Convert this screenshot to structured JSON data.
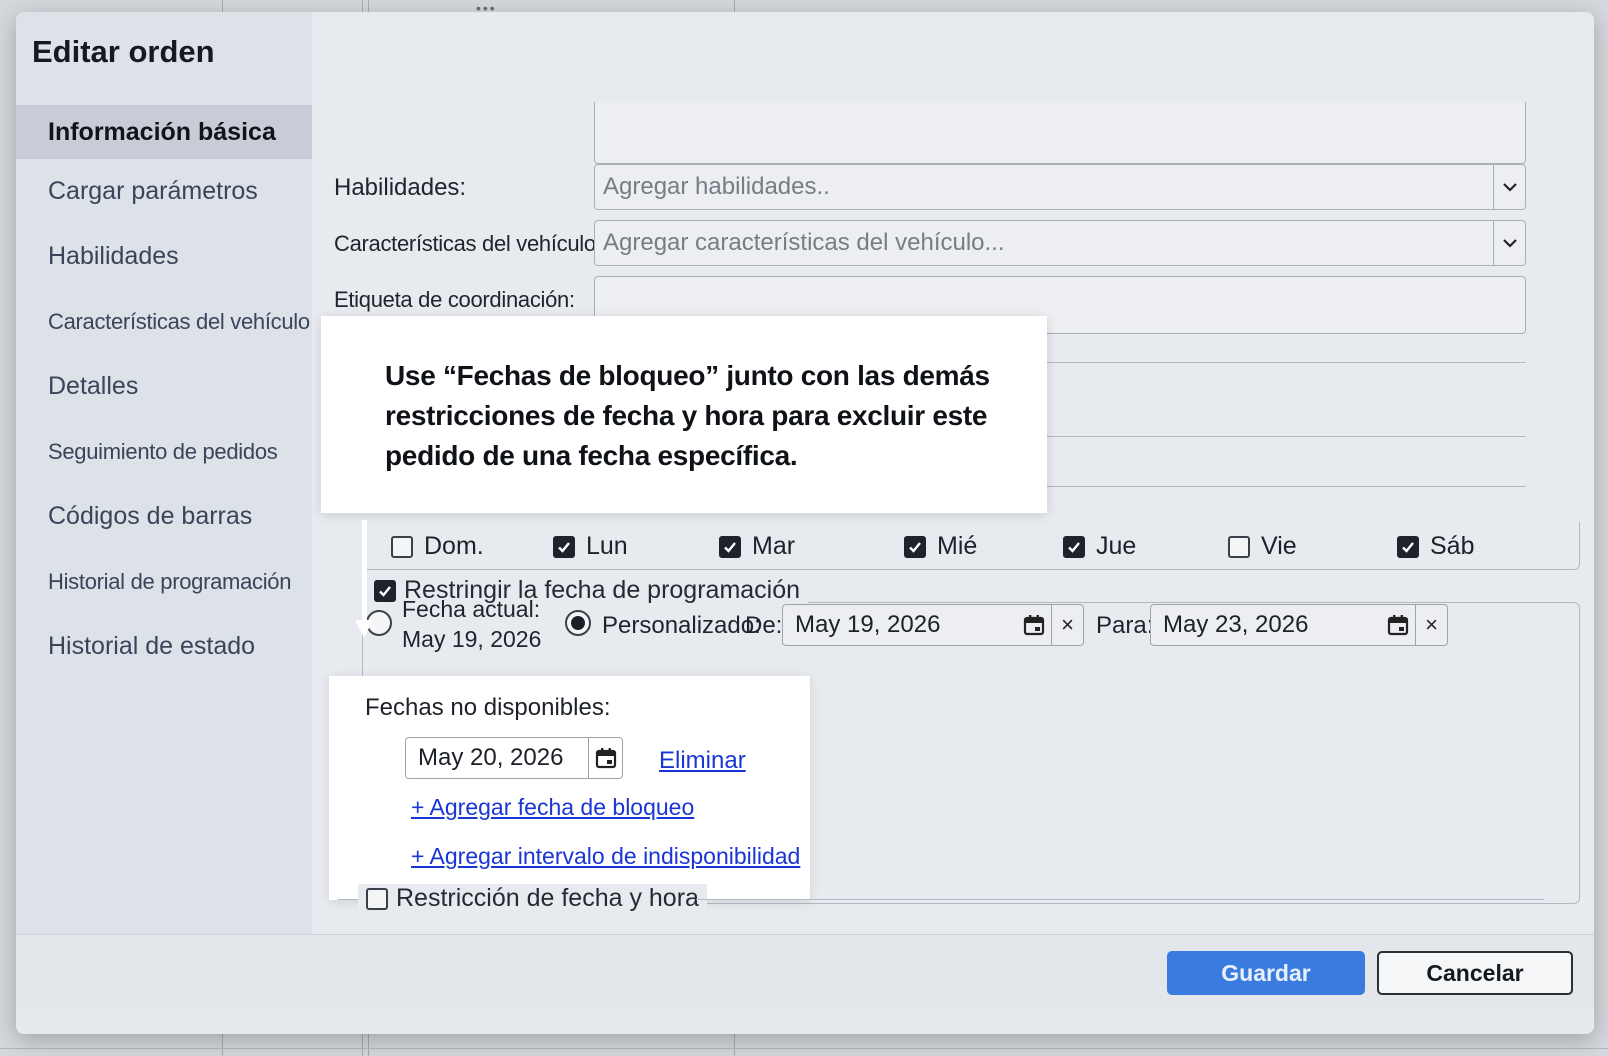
{
  "dialog": {
    "title": "Editar orden"
  },
  "sidebar": {
    "items": [
      {
        "label": "Información básica",
        "active": true
      },
      {
        "label": "Cargar parámetros"
      },
      {
        "label": "Habilidades"
      },
      {
        "label": "Características del vehículo"
      },
      {
        "label": "Detalles"
      },
      {
        "label": "Seguimiento de pedidos"
      },
      {
        "label": "Códigos de barras"
      },
      {
        "label": "Historial de programación"
      },
      {
        "label": "Historial de estado"
      }
    ]
  },
  "form": {
    "skills_label": "Habilidades:",
    "skills_placeholder": "Agregar habilidades..",
    "vehicle_label": "Características del vehículo:",
    "vehicle_placeholder": "Agregar características del vehículo...",
    "coordination_label": "Etiqueta de coordinación:",
    "coordination_value": ""
  },
  "callout": {
    "text": "Use “Fechas de bloqueo” junto con las demás restricciones de fecha y hora para excluir este pedido de una fecha específica."
  },
  "weekdays": [
    {
      "label": "Dom.",
      "checked": false
    },
    {
      "label": "Lun",
      "checked": true
    },
    {
      "label": "Mar",
      "checked": true
    },
    {
      "label": "Mié",
      "checked": true
    },
    {
      "label": "Jue",
      "checked": true
    },
    {
      "label": "Vie",
      "checked": false
    },
    {
      "label": "Sáb",
      "checked": true
    }
  ],
  "schedule_restriction": {
    "legend": "Restringir la fecha de programación",
    "checked": true,
    "current_date_label": "Fecha actual:",
    "current_date_value": "May 19, 2026",
    "custom_label": "Personalizado:",
    "selected": "custom",
    "from_label": "De:",
    "from_value": "May 19, 2026",
    "to_label": "Para:",
    "to_value": "May 23, 2026",
    "clear_glyph": "×"
  },
  "unavailable": {
    "label": "Fechas no disponibles:",
    "date_value": "May 20, 2026",
    "remove_link": "Eliminar",
    "add_block_link": "+ Agregar fecha de bloqueo",
    "add_range_link": "+ Agregar intervalo de indisponibilidad"
  },
  "datetime_restriction": {
    "legend": "Restricción de fecha y hora",
    "checked": false
  },
  "footer": {
    "save_label": "Guardar",
    "cancel_label": "Cancelar"
  },
  "colors": {
    "primary_button": "#3a7be0",
    "link": "#1a35d6",
    "active_sidebar": "#c7ccd6"
  }
}
